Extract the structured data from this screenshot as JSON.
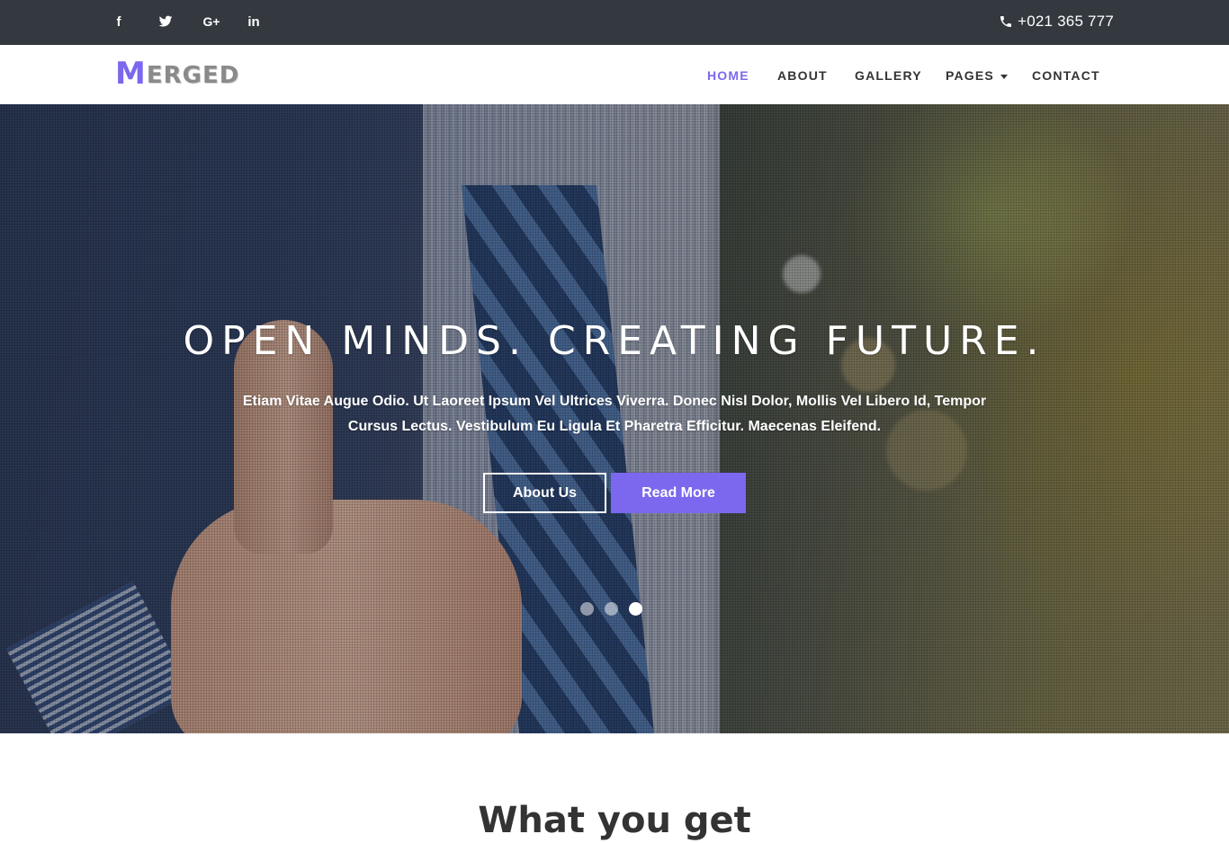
{
  "topbar": {
    "social": [
      {
        "icon": "facebook-icon",
        "glyph": "f"
      },
      {
        "icon": "twitter-icon",
        "glyph": ""
      },
      {
        "icon": "google-plus-icon",
        "glyph": "G+"
      },
      {
        "icon": "linkedin-icon",
        "glyph": "in"
      }
    ],
    "phone": "+021 365 777"
  },
  "navbar": {
    "logo_first": "M",
    "logo_rest": "ERGED",
    "items": [
      {
        "label": "HOME",
        "active": true
      },
      {
        "label": "ABOUT"
      },
      {
        "label": "GALLERY"
      },
      {
        "label": "PAGES"
      },
      {
        "label": "CONTACT"
      }
    ]
  },
  "hero": {
    "title": "OPEN MINDS. CREATING FUTURE.",
    "text": "Etiam Vitae Augue Odio. Ut Laoreet Ipsum Vel Ultrices Viverra. Donec Nisl Dolor, Mollis Vel Libero Id, Tempor Cursus Lectus. Vestibulum Eu Ligula Et Pharetra Efficitur. Maecenas Eleifend.",
    "button_about": "About Us",
    "button_read": "Read More",
    "slides_total": 3,
    "slide_active": 3
  },
  "section": {
    "title": "What you get"
  },
  "colors": {
    "accent": "#7b68ee",
    "topbar_bg": "#33393e",
    "nav_text": "#333333"
  }
}
